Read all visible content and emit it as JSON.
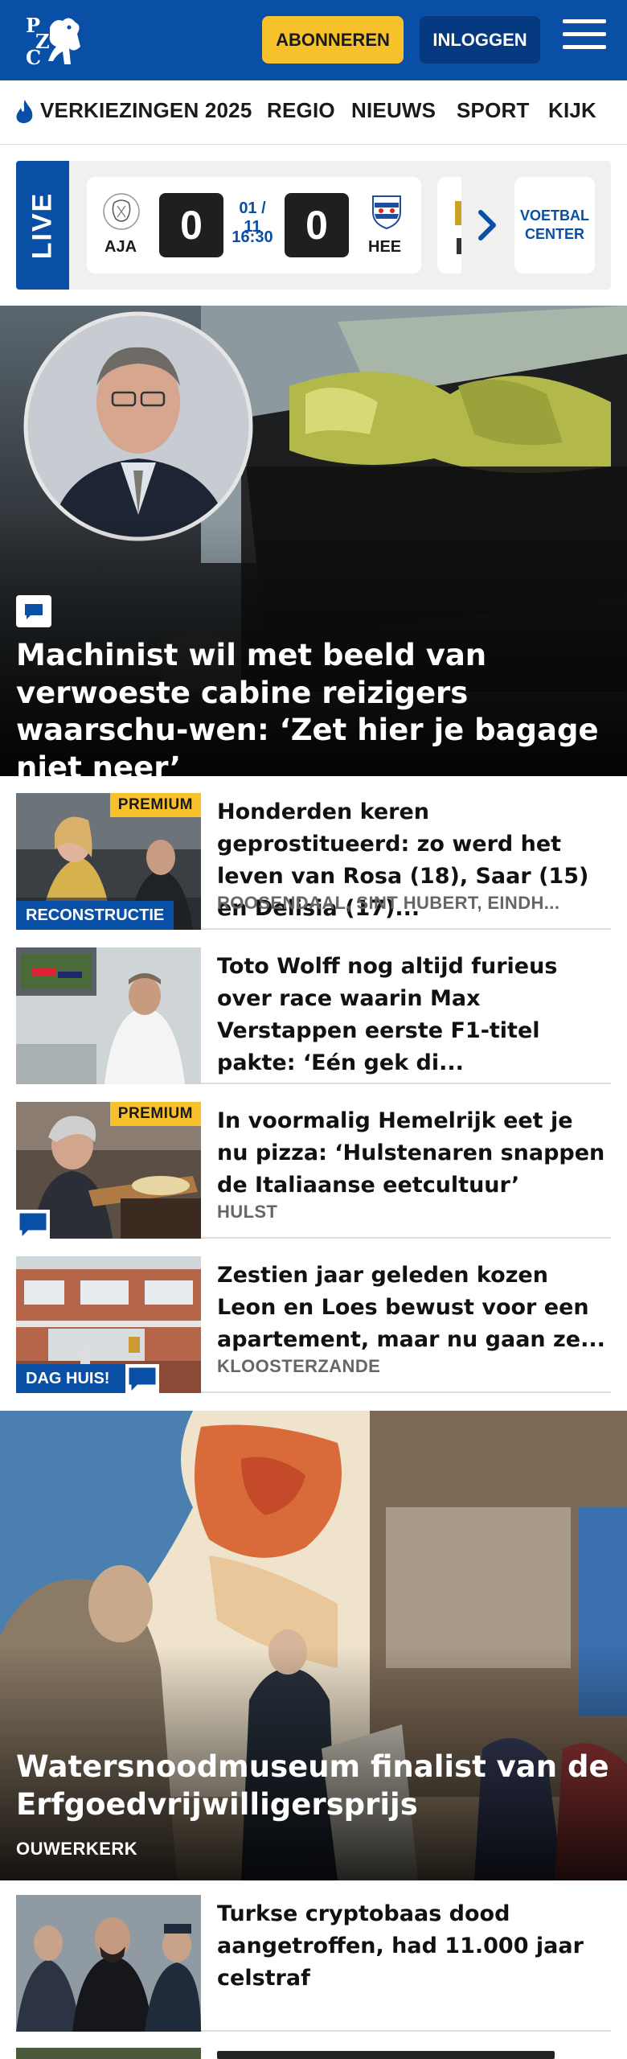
{
  "header": {
    "logo_text": "PZC",
    "subscribe_label": "ABONNEREN",
    "login_label": "INLOGGEN",
    "brand_color": "#0a4fa6",
    "accent_color": "#f6c12b"
  },
  "nav": {
    "items": [
      {
        "label": "VERKIEZINGEN 2025",
        "icon": "flame-icon"
      },
      {
        "label": "REGIO"
      },
      {
        "label": "NIEUWS"
      },
      {
        "label": "SPORT"
      },
      {
        "label": "KIJK"
      }
    ]
  },
  "live": {
    "tag": "LIVE",
    "match": {
      "home": "AJA",
      "away": "HEE",
      "home_score": "0",
      "away_score": "0",
      "date": "01 / 11",
      "time": "16:30"
    },
    "football_center_label": "VOETBAL CENTER"
  },
  "hero": {
    "title": "Machinist wil met beeld van verwoeste cabine reizigers waarschu-wen: ‘Zet hier je bagage niet neer’",
    "has_comments": true
  },
  "articles": [
    {
      "title": "Honderden keren geprostitueerd: zo werd het leven van Rosa (18), Saar (15) en Delisia (17)...",
      "location": "ROOSENDAAL, SINT HUBERT, EINDH...",
      "premium_label": "PREMIUM",
      "tag_label": "RECONSTRUCTIE"
    },
    {
      "title": "Toto Wolff nog altijd furieus over race waarin Max Verstappen eerste F1-titel pakte: ‘Eén gek di...",
      "location": ""
    },
    {
      "title": "In voormalig Hemelrijk eet je nu pizza: ‘Hulstenaren snappen de Italiaanse eetcultuur’",
      "location": "HULST",
      "premium_label": "PREMIUM",
      "has_comments": true
    },
    {
      "title": "Zestien jaar geleden kozen Leon en Loes bewust voor een apartement, maar nu gaan ze...",
      "location": "KLOOSTERZANDE",
      "tag_label": "DAG HUIS!",
      "has_comments": true
    }
  ],
  "hero2": {
    "title": "Watersnoodmuseum finalist van de Erfgoedvrijwilligersprijs",
    "location": "OUWERKERK"
  },
  "articles2": [
    {
      "title": "Turkse cryptobaas dood aangetroffen, had 11.000 jaar celstraf",
      "location": ""
    }
  ]
}
